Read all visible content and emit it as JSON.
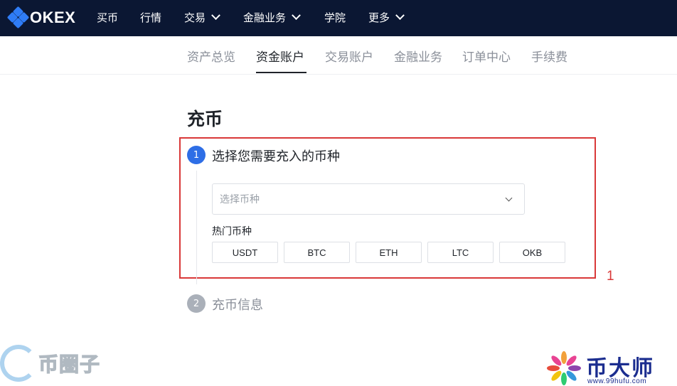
{
  "brand": {
    "name": "OKEX",
    "color": "#2f7cf6"
  },
  "topnav": {
    "items": [
      {
        "label": "买币",
        "dropdown": false
      },
      {
        "label": "行情",
        "dropdown": false
      },
      {
        "label": "交易",
        "dropdown": true
      },
      {
        "label": "金融业务",
        "dropdown": true
      },
      {
        "label": "学院",
        "dropdown": false
      },
      {
        "label": "更多",
        "dropdown": true
      }
    ]
  },
  "subnav": {
    "active": "资金账户",
    "items": [
      "资产总览",
      "资金账户",
      "交易账户",
      "金融业务",
      "订单中心",
      "手续费"
    ]
  },
  "page": {
    "title": "充币",
    "steps": [
      {
        "number": "1",
        "title": "选择您需要充入的币种",
        "active": true
      },
      {
        "number": "2",
        "title": "充币信息",
        "active": false
      }
    ],
    "coin_select": {
      "placeholder": "选择币种"
    },
    "hot_coins": {
      "label": "热门币种",
      "coins": [
        "USDT",
        "BTC",
        "ETH",
        "LTC",
        "OKB"
      ]
    }
  },
  "annotation": {
    "label": "1",
    "color": "#d93838"
  },
  "watermarks": {
    "left_text": "币圈子",
    "right_text": "币大师",
    "right_url": "www.99hufu.com"
  }
}
